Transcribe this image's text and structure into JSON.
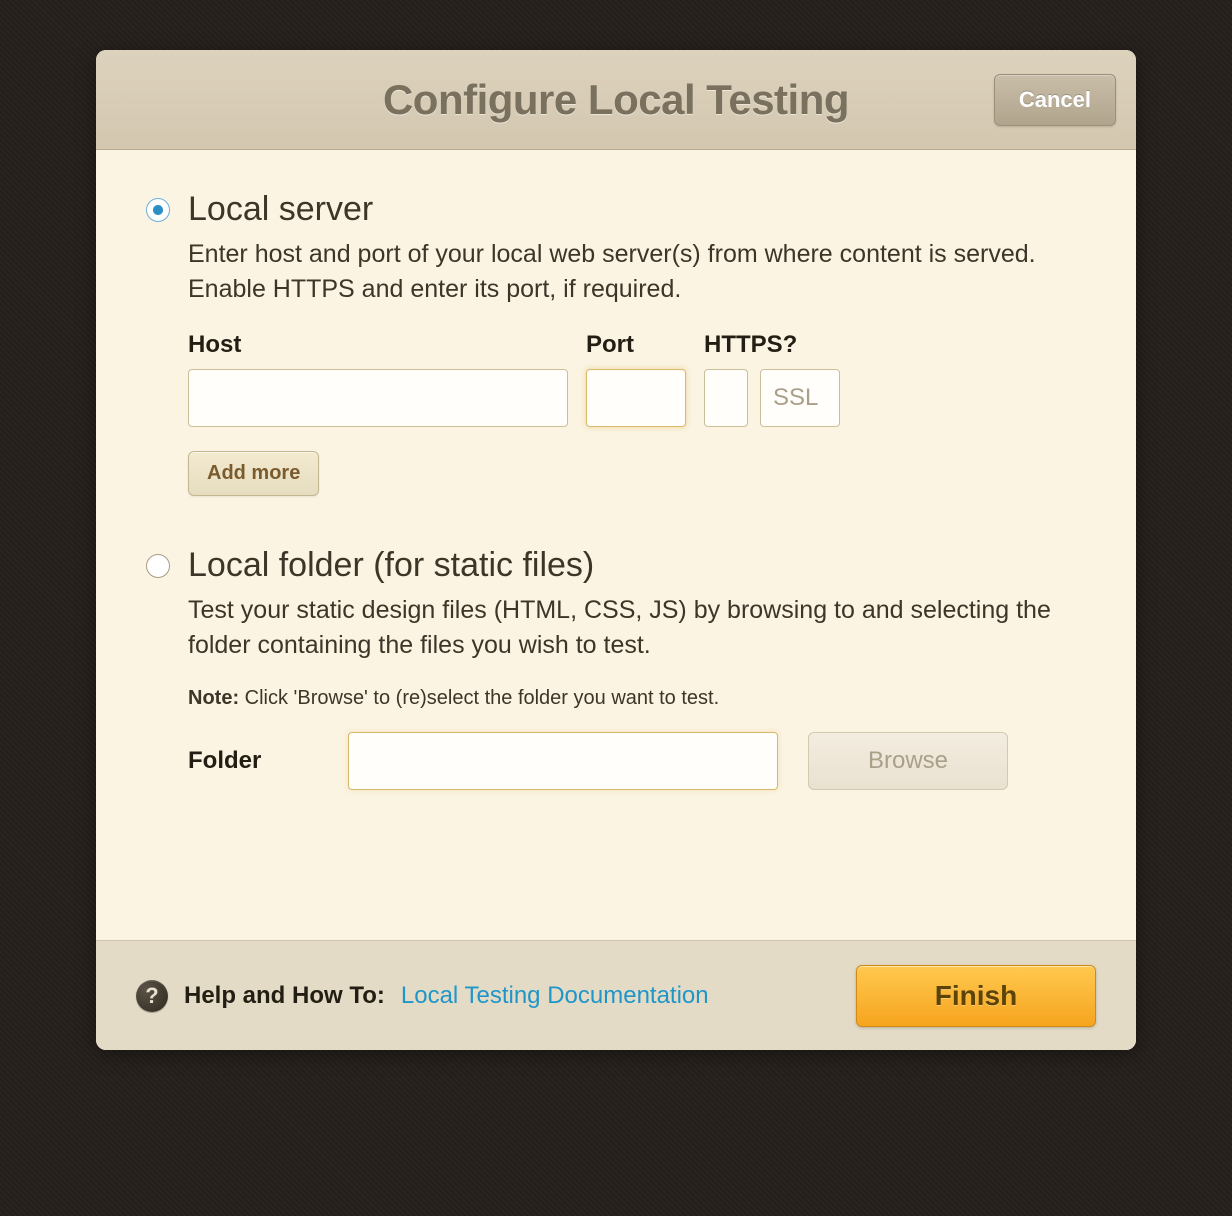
{
  "dialog": {
    "title": "Configure Local Testing",
    "cancel_label": "Cancel"
  },
  "local_server": {
    "title": "Local server",
    "description": "Enter host and port of your local web server(s) from where content is served. Enable HTTPS and enter its port, if required.",
    "host_label": "Host",
    "port_label": "Port",
    "https_label": "HTTPS?",
    "host_value": "",
    "port_value": "",
    "https_checked": false,
    "ssl_placeholder": "SSL",
    "ssl_value": "",
    "add_more_label": "Add more",
    "selected": true
  },
  "local_folder": {
    "title": "Local folder (for static files)",
    "description": "Test your static design files (HTML, CSS, JS) by browsing to and selecting the folder containing the files you wish to test.",
    "note_prefix": "Note:",
    "note_text": " Click 'Browse' to (re)select the folder you want to test.",
    "folder_label": "Folder",
    "folder_value": "",
    "browse_label": "Browse",
    "selected": false
  },
  "footer": {
    "help_label": "Help and How To: ",
    "help_link_text": "Local Testing Documentation",
    "finish_label": "Finish"
  }
}
